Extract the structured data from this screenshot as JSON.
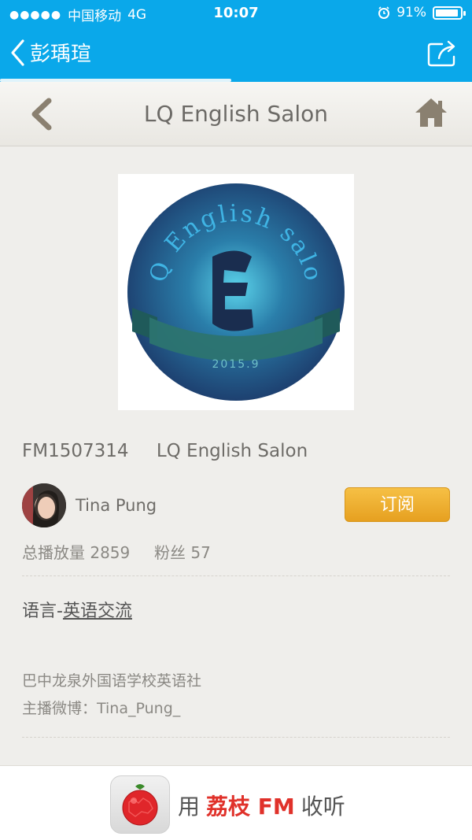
{
  "status_bar": {
    "signal_dots": "●●●●●",
    "carrier": "中国移动",
    "network": "4G",
    "time": "10:07",
    "battery": "91%"
  },
  "nav": {
    "back_label": "彭瑀瑄",
    "progress_fraction": 0.49
  },
  "header": {
    "title": "LQ English Salon"
  },
  "cover": {
    "arc_text": "LQ English salon",
    "year": "2015.9"
  },
  "channel": {
    "id": "FM1507314",
    "name": "LQ English Salon"
  },
  "host": {
    "name": "Tina Pung",
    "subscribe_label": "订阅"
  },
  "stats": {
    "plays_label": "总播放量",
    "plays": "2859",
    "fans_label": "粉丝",
    "fans": "57"
  },
  "category": {
    "prefix": "语言-",
    "link": "英语交流"
  },
  "description": {
    "line1": "巴中龙泉外国语学校英语社",
    "line2": "主播微博：Tina_Pung_"
  },
  "banner": {
    "prefix": "用",
    "brand": "荔枝",
    "brand_fm": "FM",
    "suffix": "收听"
  },
  "colors": {
    "topbar": "#0aa8ea",
    "subscribe": "#e6a020",
    "brand_red": "#e0312a"
  }
}
